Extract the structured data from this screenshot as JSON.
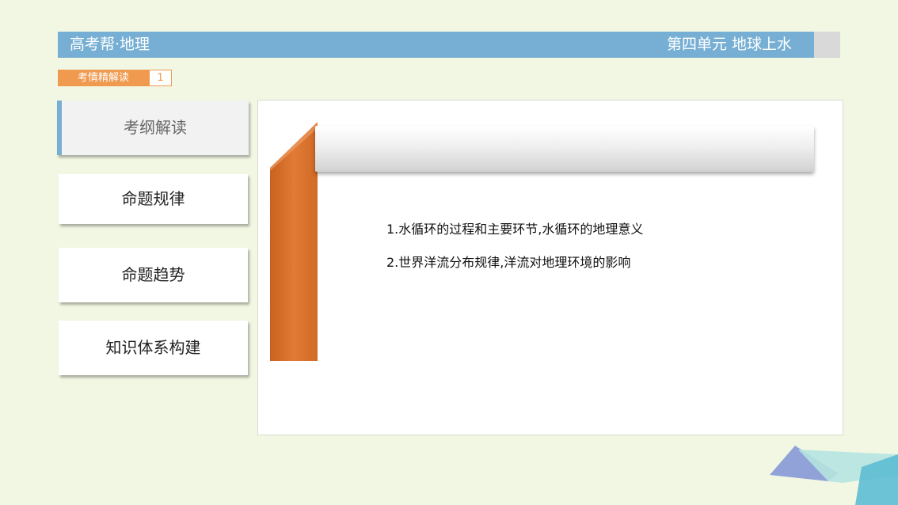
{
  "header": {
    "left_title": "高考帮·地理",
    "right_title": "第四单元 地球上水"
  },
  "tag": {
    "label": "考情精解读",
    "number": "1"
  },
  "nav": {
    "items": [
      {
        "label": "考纲解读",
        "active": true
      },
      {
        "label": "命题规律",
        "active": false
      },
      {
        "label": "命题趋势",
        "active": false
      },
      {
        "label": "知识体系构建",
        "active": false
      }
    ]
  },
  "main": {
    "title": "",
    "lines": [
      "1.水循环的过程和主要环节,水循环的地理意义",
      "2.世界洋流分布规律,洋流对地理环境的影响"
    ]
  },
  "colors": {
    "header_blue": "#76afd3",
    "accent_orange": "#e07a34",
    "tag_orange": "#ef9a4f",
    "background": "#f1f7e3"
  }
}
